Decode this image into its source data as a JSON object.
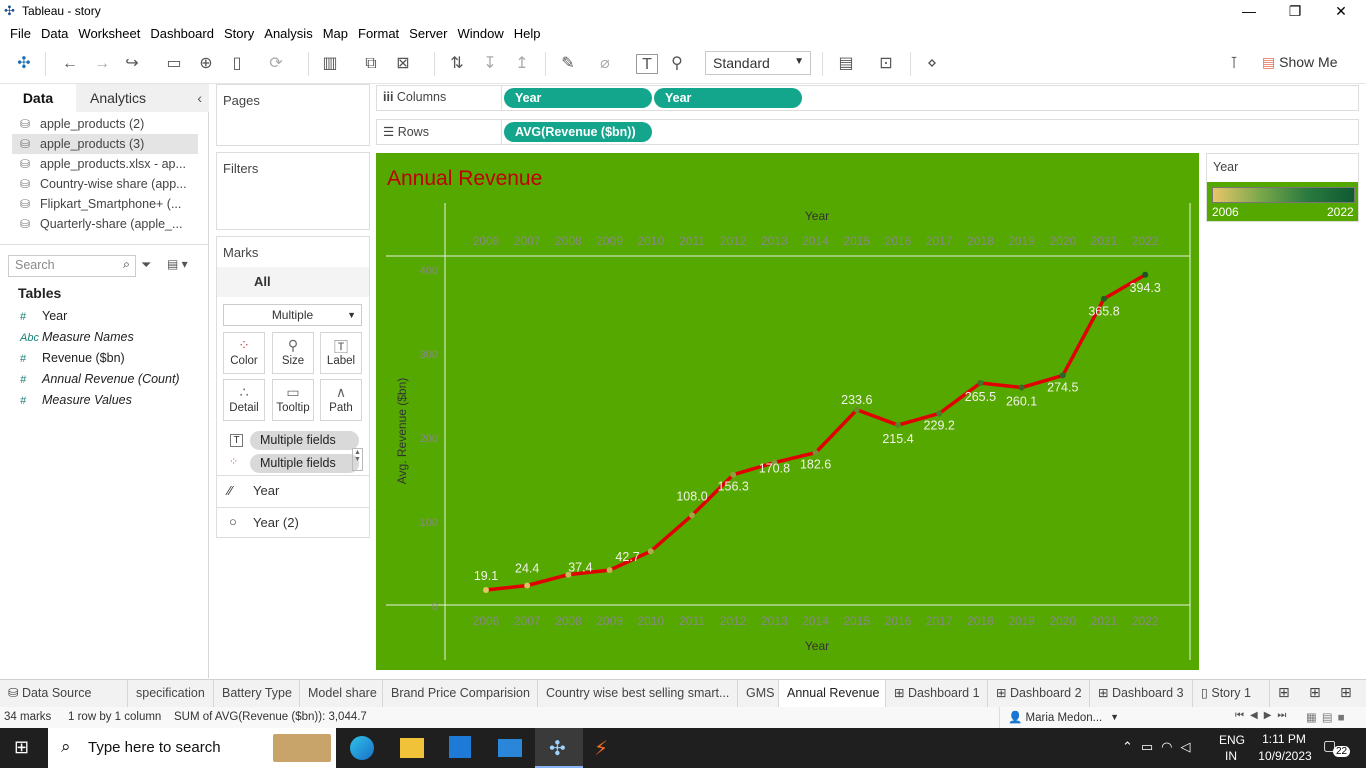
{
  "window": {
    "title": "Tableau - story"
  },
  "menu": [
    "File",
    "Data",
    "Worksheet",
    "Dashboard",
    "Story",
    "Analysis",
    "Map",
    "Format",
    "Server",
    "Window",
    "Help"
  ],
  "toolbar": {
    "fit_value": "Standard",
    "show_me": "Show Me"
  },
  "left_panel": {
    "tab_data": "Data",
    "tab_analytics": "Analytics",
    "datasources": [
      "apple_products (2)",
      "apple_products (3)",
      "apple_products.xlsx - ap...",
      "Country-wise share (app...",
      "Flipkart_Smartphone+ (...",
      "Quarterly-share (apple_..."
    ],
    "search_placeholder": "Search",
    "tables_label": "Tables",
    "fields": [
      {
        "type": "#",
        "name": "Year",
        "italic": false
      },
      {
        "type": "Abc",
        "name": "Measure Names",
        "italic": true
      },
      {
        "type": "#",
        "name": "Revenue ($bn)",
        "italic": false
      },
      {
        "type": "#",
        "name": "Annual Revenue (Count)",
        "italic": true
      },
      {
        "type": "#",
        "name": "Measure Values",
        "italic": true
      }
    ]
  },
  "shelves": {
    "pages": "Pages",
    "filters": "Filters",
    "columns_label": "Columns",
    "rows_label": "Rows",
    "columns_pills": [
      "Year",
      "Year"
    ],
    "rows_pills": [
      "AVG(Revenue ($bn))"
    ]
  },
  "marks": {
    "title": "Marks",
    "all": "All",
    "type": "Multiple",
    "buttons": [
      "Color",
      "Size",
      "Label",
      "Detail",
      "Tooltip",
      "Path"
    ],
    "fields": [
      "Multiple fields",
      "Multiple fields"
    ],
    "layers": [
      "Year",
      "Year (2)"
    ]
  },
  "legend": {
    "title": "Year",
    "min": "2006",
    "max": "2022"
  },
  "chart_data": {
    "type": "line",
    "title": "Annual Revenue",
    "xlabel": "Year",
    "ylabel": "Avg. Revenue ($bn)",
    "x": [
      2006,
      2007,
      2008,
      2009,
      2010,
      2011,
      2012,
      2013,
      2014,
      2015,
      2016,
      2017,
      2018,
      2019,
      2020,
      2021,
      2022
    ],
    "values": [
      19.1,
      24.4,
      37.4,
      42.7,
      65.2,
      108.0,
      156.3,
      170.8,
      182.6,
      233.6,
      215.4,
      229.2,
      265.5,
      260.1,
      274.5,
      365.8,
      394.3
    ],
    "labels": [
      "19.1",
      "24.4",
      "37.4",
      "42.7",
      "",
      "108.0",
      "156.3",
      "170.8",
      "182.6",
      "233.6",
      "215.4",
      "229.2",
      "265.5",
      "260.1",
      "274.5",
      "365.8",
      "394.3"
    ],
    "yticks": [
      0,
      100,
      200,
      300,
      400
    ],
    "ylim": [
      0,
      400
    ],
    "line_color": "#e00000",
    "background": "#55a800",
    "grid": false
  },
  "sheet_tabs": [
    "Data Source",
    "specification",
    "Battery Type",
    "Model share",
    "Brand Price Comparision",
    "Country wise best selling smart...",
    "GMS",
    "Annual Revenue",
    "Dashboard 1",
    "Dashboard 2",
    "Dashboard 3",
    "Story 1"
  ],
  "active_tab": "Annual Revenue",
  "status": {
    "marks": "34 marks",
    "dims": "1 row by 1 column",
    "sum": "SUM of AVG(Revenue ($bn)): 3,044.7",
    "user": "Maria Medon..."
  },
  "taskbar": {
    "search": "Type here to search",
    "lang1": "ENG",
    "lang2": "IN",
    "time": "1:11 PM",
    "date": "10/9/2023",
    "notif": "22"
  }
}
